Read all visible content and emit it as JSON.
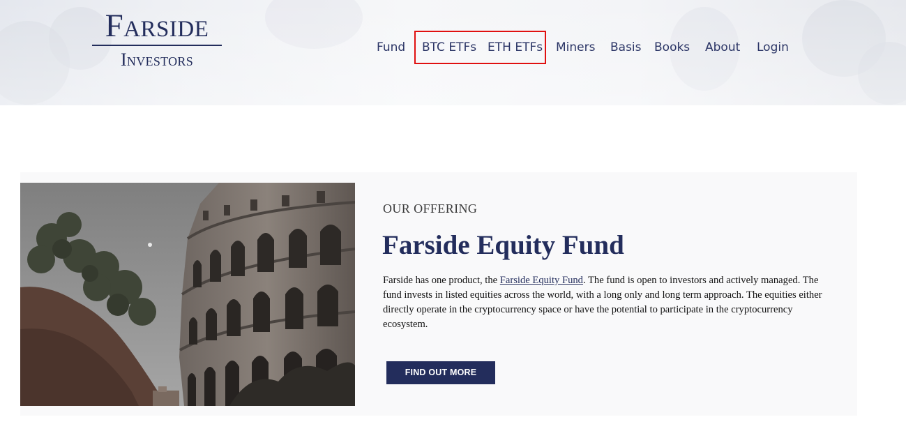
{
  "brand": {
    "name": "Farside",
    "subtitle": "Investors"
  },
  "nav": {
    "items": [
      {
        "label": "Fund"
      },
      {
        "label": "BTC ETFs"
      },
      {
        "label": "ETH ETFs"
      },
      {
        "label": "Miners"
      },
      {
        "label": "Basis"
      },
      {
        "label": "Books"
      },
      {
        "label": "About"
      },
      {
        "label": "Login"
      }
    ],
    "highlight_color": "#e01010"
  },
  "offering": {
    "eyebrow": "OUR OFFERING",
    "title": "Farside Equity Fund",
    "body_before_link": "Farside has one product, the ",
    "body_link": "Farside Equity Fund",
    "body_after_link": ". The fund is open to investors and actively managed. The fund invests in listed equities across the world, with a long only and long term approach. The equities either directly operate in the cryptocurrency space or have the potential to participate in the cryptocurrency ecosystem.",
    "cta_label": "FIND OUT MORE",
    "image_subject": "colosseum-photo"
  },
  "colors": {
    "brand_navy": "#232d5c",
    "card_background": "#f9f9fa"
  }
}
